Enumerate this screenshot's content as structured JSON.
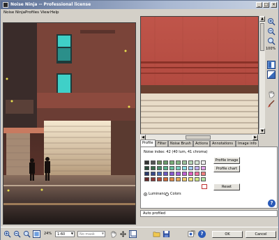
{
  "window": {
    "title": "Noise Ninja -- Professional license",
    "minimize": "_",
    "maximize": "□",
    "close": "×"
  },
  "menu": [
    "Noise Ninja",
    "Profiles",
    "View",
    "Help"
  ],
  "zoom_panel": {
    "zoom_level": "100%"
  },
  "tabs": [
    "Profile",
    "Filter",
    "Noise Brush",
    "Actions",
    "Annotations",
    "Image info"
  ],
  "profile": {
    "noise_index": "Noise index:  42 (40 lum, 41 chroma)",
    "profile_image_button": "Profile image",
    "profile_chart_button": "Profile chart",
    "reset_button": "Reset",
    "luminance_label": "Luminance",
    "colors_label": "Colors"
  },
  "status_text": "Auto profiled",
  "bottom": {
    "zoom_percent": "24%",
    "fit_value": "1:60",
    "mask_value": "No mask",
    "ok_button": "OK",
    "cancel_button": "Cancel"
  },
  "colors": {
    "title_start": "#5b6f95",
    "wall_red": "#c0554a",
    "window_cyan": "#3fd0c8",
    "panel_bg": "#d4d0c8"
  }
}
